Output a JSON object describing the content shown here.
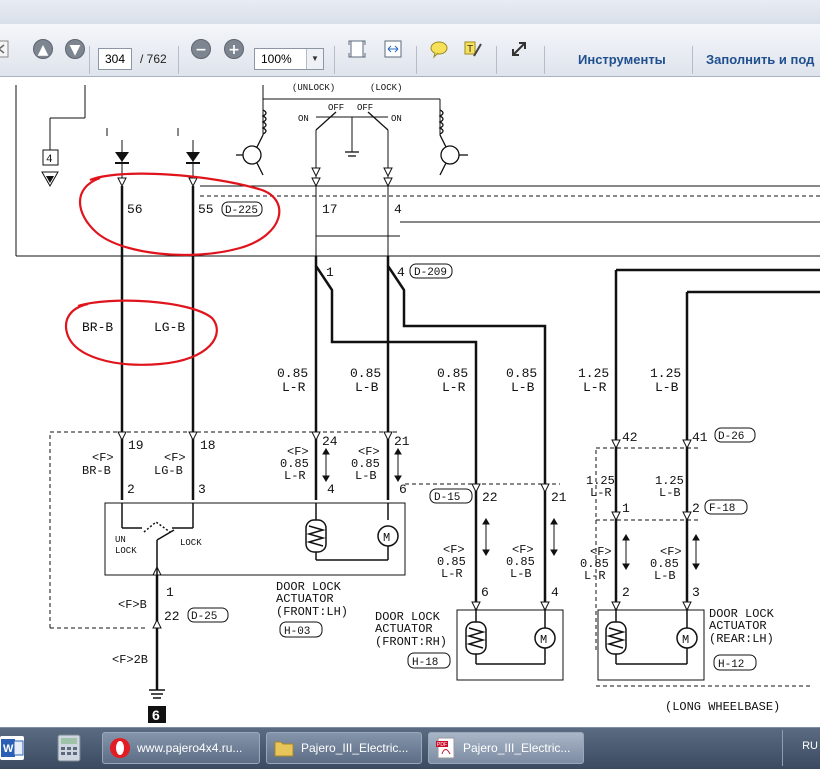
{
  "toolbar": {
    "current_page": "304",
    "page_total": "/ 762",
    "zoom": "100%",
    "tools_label": "Инструменты",
    "fill_sign_label": "Заполнить и под"
  },
  "diagram": {
    "unlock": "(UNLOCK)",
    "lock": "(LOCK)",
    "off": "OFF",
    "on": "ON",
    "box_num": "4",
    "pins_top": [
      "56",
      "55",
      "17",
      "4"
    ],
    "conn_d225": "D-225",
    "wire_brb": "BR-B",
    "wire_lgb": "LG-B",
    "pins_d209": [
      "1",
      "4"
    ],
    "conn_d209": "D-209",
    "gauge_085": "0.85",
    "gauge_125": "1.25",
    "wire_lr": "L-R",
    "wire_lb": "L-B",
    "f_tag": "<F>",
    "pins_f": [
      "19",
      "18",
      "24",
      "21",
      "42",
      "41"
    ],
    "conn_d26": "D-26",
    "pins_actuator_lh": [
      "2",
      "3",
      "4",
      "6"
    ],
    "unlock_sw": "UN\nLOCK",
    "un": "UN",
    "lk": "LOCK",
    "lock_sw": "LOCK",
    "conn_d15": "D-15",
    "pins_d15": [
      "22",
      "21"
    ],
    "pins_f18": [
      "1",
      "2"
    ],
    "conn_f18": "F-18",
    "pin_1": "1",
    "fb": "<F>B",
    "pin_22": "22",
    "conn_d25": "D-25",
    "f2b": "<F>2B",
    "ground_num": "6",
    "act_title1": "DOOR LOCK",
    "act_title2": "ACTUATOR",
    "front_lh": "(FRONT:LH)",
    "front_rh": "(FRONT:RH)",
    "rear_lh": "(REAR:LH)",
    "conn_h03": "H-03",
    "conn_h18": "H-18",
    "conn_h12": "H-12",
    "pins_h18": [
      "6",
      "4"
    ],
    "pins_h12": [
      "2",
      "3"
    ],
    "long_wheelbase": "(LONG WHEELBASE)"
  },
  "taskbar": {
    "opera_label": "www.pajero4x4.ru...",
    "folder_label": "Pajero_III_Electric...",
    "pdf_label": "Pajero_III_Electric...",
    "lang": "RU"
  },
  "colors": {
    "annotation": "#e0141c",
    "link": "#1f4f8f"
  }
}
